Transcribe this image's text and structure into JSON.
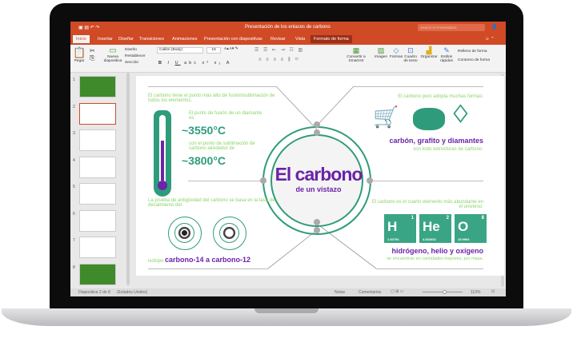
{
  "window": {
    "title": "Presentación de los enlaces de carbono",
    "search_placeholder": "Search in Presentation"
  },
  "tabs": [
    "Inicio",
    "Insertar",
    "Diseñar",
    "Transiciones",
    "Animaciones",
    "Presentación con diapositivas",
    "Revisar",
    "Vista",
    "Formato de forma"
  ],
  "ribbon": {
    "paste": "Pegar",
    "new_slide": "Nueva diapositiva",
    "layout": "Diseño",
    "reset": "Restablecer",
    "section": "Sección",
    "font": "Calibri (Body)",
    "size": "18",
    "convert": "Convertir a SmartArt",
    "image": "Imagen",
    "shapes": "Formas",
    "textbox": "Cuadro de texto",
    "arrange": "Organizar",
    "quick_styles": "Estilos rápidos",
    "fill": "Relleno de forma",
    "outline": "Contorno de forma"
  },
  "thumbnails": [
    "1",
    "2",
    "3",
    "4",
    "5",
    "6",
    "7",
    "8"
  ],
  "slide": {
    "title": "El carbono",
    "subtitle": "de un vistazo",
    "melt_intro": "El carbono tiene el punto más alto de fusión/sublimación de todos los elementos.",
    "melt_label": "El punto de fusión de un diamante es",
    "melt_value": "~3550°C",
    "sub_label": "con el punto de sublimación de carbono alrededor de",
    "sub_value": "~3800°C",
    "forms_intro": "El carbono puro adopta muchas formas:",
    "forms_title": "carbón, grafito y diamantes",
    "forms_note": "son todo estructuras de carbono.",
    "dating_intro": "La prueba de antigüedad del carbono se basa en la tasa de decaimiento del",
    "isotope_prefix": "isótopo",
    "isotope_title": "carbono-14 a carbono-12",
    "abundance_intro": "El carbono es el cuarto elemento más abundante en el universo:",
    "elements": [
      {
        "symbol": "H",
        "number": "1",
        "mass": "1.00794"
      },
      {
        "symbol": "He",
        "number": "2",
        "mass": "4.002602"
      },
      {
        "symbol": "O",
        "number": "8",
        "mass": "15.9994"
      }
    ],
    "abundance_title": "hidrógeno, helio y oxígeno",
    "abundance_note": "se encuentran en cantidades mayores, por masa."
  },
  "status": {
    "slide_info": "Diapositiva 2 de 8",
    "language": "(Estados Unidos)",
    "notes": "Notas",
    "comments": "Comentarios",
    "zoom": "110%"
  },
  "colors": {
    "accent": "#d04a26",
    "teal": "#2e9c7b",
    "purple": "#6b23a8",
    "green": "#8bd36a"
  }
}
